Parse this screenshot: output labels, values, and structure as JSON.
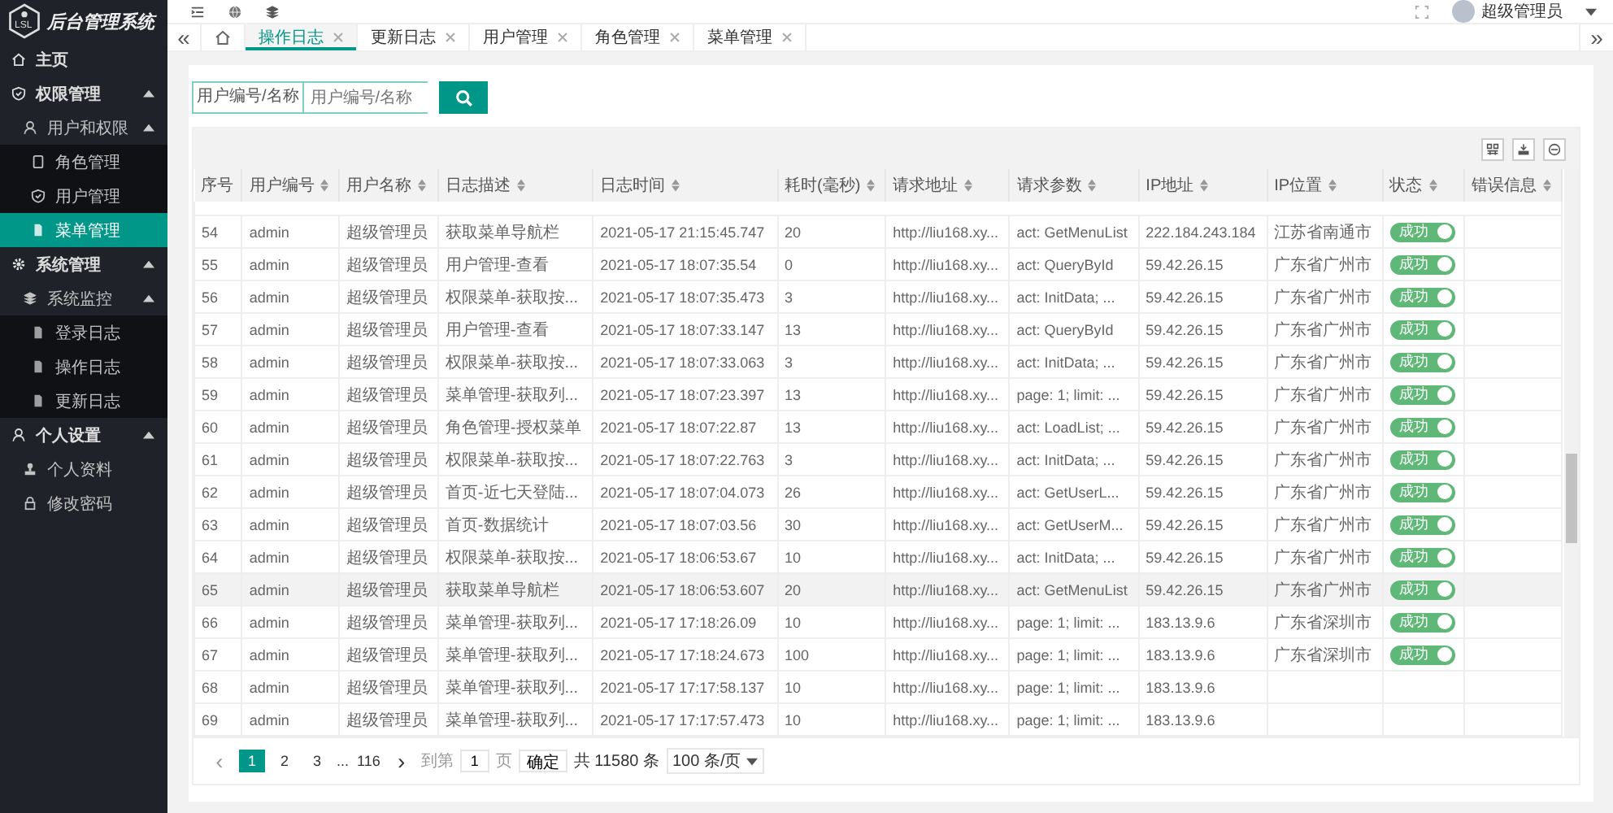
{
  "brand": {
    "logo_text": "LSL",
    "title": "后台管理系统"
  },
  "sidebar": {
    "items": [
      {
        "label": "主页",
        "selected": false
      },
      {
        "label": "权限管理",
        "expanded": true,
        "selected": false,
        "children": [
          {
            "label": "用户和权限",
            "expanded": true,
            "selected": false,
            "children": [
              {
                "label": "角色管理",
                "selected": false
              },
              {
                "label": "用户管理",
                "selected": false
              },
              {
                "label": "菜单管理",
                "selected": true
              }
            ]
          }
        ]
      },
      {
        "label": "系统管理",
        "expanded": true,
        "selected": false,
        "children": [
          {
            "label": "系统监控",
            "expanded": true,
            "selected": false,
            "children": [
              {
                "label": "登录日志",
                "selected": false
              },
              {
                "label": "操作日志",
                "selected": false
              },
              {
                "label": "更新日志",
                "selected": false
              }
            ]
          }
        ]
      },
      {
        "label": "个人设置",
        "expanded": true,
        "selected": false,
        "children": [
          {
            "label": "个人资料",
            "selected": false
          },
          {
            "label": "修改密码",
            "selected": false
          }
        ]
      }
    ]
  },
  "tab_scroll": {
    "left": "«",
    "right": "»"
  },
  "header": {
    "user_name": "超级管理员"
  },
  "tabs": [
    {
      "label": "操作日志",
      "selected": true
    },
    {
      "label": "更新日志",
      "selected": false
    },
    {
      "label": "用户管理",
      "selected": false
    },
    {
      "label": "角色管理",
      "selected": false
    },
    {
      "label": "菜单管理",
      "selected": false
    }
  ],
  "search": {
    "label": "用户编号/名称",
    "placeholder": "用户编号/名称"
  },
  "table": {
    "columns": [
      {
        "label": "序号",
        "sortable": false
      },
      {
        "label": "用户编号",
        "sortable": true
      },
      {
        "label": "用户名称",
        "sortable": true
      },
      {
        "label": "日志描述",
        "sortable": true
      },
      {
        "label": "日志时间",
        "sortable": true
      },
      {
        "label": "耗时(毫秒)",
        "sortable": true
      },
      {
        "label": "请求地址",
        "sortable": true
      },
      {
        "label": "请求参数",
        "sortable": true
      },
      {
        "label": "IP地址",
        "sortable": true
      },
      {
        "label": "IP位置",
        "sortable": true
      },
      {
        "label": "状态",
        "sortable": true
      },
      {
        "label": "错误信息",
        "sortable": true
      }
    ],
    "rows": [
      {
        "cells": [
          "54",
          "admin",
          "超级管理员",
          "获取菜单导航栏",
          "2021-05-17 21:15:45.747",
          "20",
          "http://liu168.xy...",
          "act: GetMenuList",
          "222.184.243.184",
          "江苏省南通市"
        ],
        "status": {
          "label": "成功",
          "on": true
        },
        "selected": false
      },
      {
        "cells": [
          "55",
          "admin",
          "超级管理员",
          "用户管理-查看",
          "2021-05-17 18:07:35.54",
          "0",
          "http://liu168.xy...",
          "act: QueryById",
          "59.42.26.15",
          "广东省广州市"
        ],
        "status": {
          "label": "成功",
          "on": true
        },
        "selected": false
      },
      {
        "cells": [
          "56",
          "admin",
          "超级管理员",
          "权限菜单-获取按...",
          "2021-05-17 18:07:35.473",
          "3",
          "http://liu168.xy...",
          "act: InitData; ...",
          "59.42.26.15",
          "广东省广州市"
        ],
        "status": {
          "label": "成功",
          "on": true
        },
        "selected": false
      },
      {
        "cells": [
          "57",
          "admin",
          "超级管理员",
          "用户管理-查看",
          "2021-05-17 18:07:33.147",
          "13",
          "http://liu168.xy...",
          "act: QueryById",
          "59.42.26.15",
          "广东省广州市"
        ],
        "status": {
          "label": "成功",
          "on": true
        },
        "selected": false
      },
      {
        "cells": [
          "58",
          "admin",
          "超级管理员",
          "权限菜单-获取按...",
          "2021-05-17 18:07:33.063",
          "3",
          "http://liu168.xy...",
          "act: InitData; ...",
          "59.42.26.15",
          "广东省广州市"
        ],
        "status": {
          "label": "成功",
          "on": true
        },
        "selected": false
      },
      {
        "cells": [
          "59",
          "admin",
          "超级管理员",
          "菜单管理-获取列...",
          "2021-05-17 18:07:23.397",
          "13",
          "http://liu168.xy...",
          "page: 1; limit: ...",
          "59.42.26.15",
          "广东省广州市"
        ],
        "status": {
          "label": "成功",
          "on": true
        },
        "selected": false
      },
      {
        "cells": [
          "60",
          "admin",
          "超级管理员",
          "角色管理-授权菜单",
          "2021-05-17 18:07:22.87",
          "13",
          "http://liu168.xy...",
          "act: LoadList; ...",
          "59.42.26.15",
          "广东省广州市"
        ],
        "status": {
          "label": "成功",
          "on": true
        },
        "selected": false
      },
      {
        "cells": [
          "61",
          "admin",
          "超级管理员",
          "权限菜单-获取按...",
          "2021-05-17 18:07:22.763",
          "3",
          "http://liu168.xy...",
          "act: InitData; ...",
          "59.42.26.15",
          "广东省广州市"
        ],
        "status": {
          "label": "成功",
          "on": true
        },
        "selected": false
      },
      {
        "cells": [
          "62",
          "admin",
          "超级管理员",
          "首页-近七天登陆...",
          "2021-05-17 18:07:04.073",
          "26",
          "http://liu168.xy...",
          "act: GetUserL...",
          "59.42.26.15",
          "广东省广州市"
        ],
        "status": {
          "label": "成功",
          "on": true
        },
        "selected": false
      },
      {
        "cells": [
          "63",
          "admin",
          "超级管理员",
          "首页-数据统计",
          "2021-05-17 18:07:03.56",
          "30",
          "http://liu168.xy...",
          "act: GetUserM...",
          "59.42.26.15",
          "广东省广州市"
        ],
        "status": {
          "label": "成功",
          "on": true
        },
        "selected": false
      },
      {
        "cells": [
          "64",
          "admin",
          "超级管理员",
          "权限菜单-获取按...",
          "2021-05-17 18:06:53.67",
          "10",
          "http://liu168.xy...",
          "act: InitData; ...",
          "59.42.26.15",
          "广东省广州市"
        ],
        "status": {
          "label": "成功",
          "on": true
        },
        "selected": false
      },
      {
        "cells": [
          "65",
          "admin",
          "超级管理员",
          "获取菜单导航栏",
          "2021-05-17 18:06:53.607",
          "20",
          "http://liu168.xy...",
          "act: GetMenuList",
          "59.42.26.15",
          "广东省广州市"
        ],
        "status": {
          "label": "成功",
          "on": true
        },
        "selected": true
      },
      {
        "cells": [
          "66",
          "admin",
          "超级管理员",
          "菜单管理-获取列...",
          "2021-05-17 17:18:26.09",
          "10",
          "http://liu168.xy...",
          "page: 1; limit: ...",
          "183.13.9.6",
          "广东省深圳市"
        ],
        "status": {
          "label": "成功",
          "on": true
        },
        "selected": false
      },
      {
        "cells": [
          "67",
          "admin",
          "超级管理员",
          "菜单管理-获取列...",
          "2021-05-17 17:18:24.673",
          "100",
          "http://liu168.xy...",
          "page: 1; limit: ...",
          "183.13.9.6",
          "广东省深圳市"
        ],
        "status": {
          "label": "成功",
          "on": true
        },
        "selected": false
      },
      {
        "cells": [
          "68",
          "admin",
          "超级管理员",
          "菜单管理-获取列...",
          "2021-05-17 17:17:58.137",
          "10",
          "http://liu168.xy...",
          "page: 1; limit: ...",
          "183.13.9.6"
        ],
        "selected": false
      },
      {
        "cells": [
          "69",
          "admin",
          "超级管理员",
          "菜单管理-获取列...",
          "2021-05-17 17:17:57.473",
          "10",
          "http://liu168.xy...",
          "page: 1; limit: ...",
          "183.13.9.6"
        ],
        "selected": false
      }
    ]
  },
  "pagination": {
    "prev": "‹",
    "next": "›",
    "pages": [
      {
        "label": "1",
        "selected": true
      },
      {
        "label": "2",
        "selected": false
      },
      {
        "label": "3",
        "selected": false
      }
    ],
    "ellipsis": "...",
    "last_page": "116",
    "goto_label": "到第",
    "page_input": "1",
    "page_unit": "页",
    "confirm": "确定",
    "total": "共 11580 条",
    "page_size": "100 条/页"
  }
}
